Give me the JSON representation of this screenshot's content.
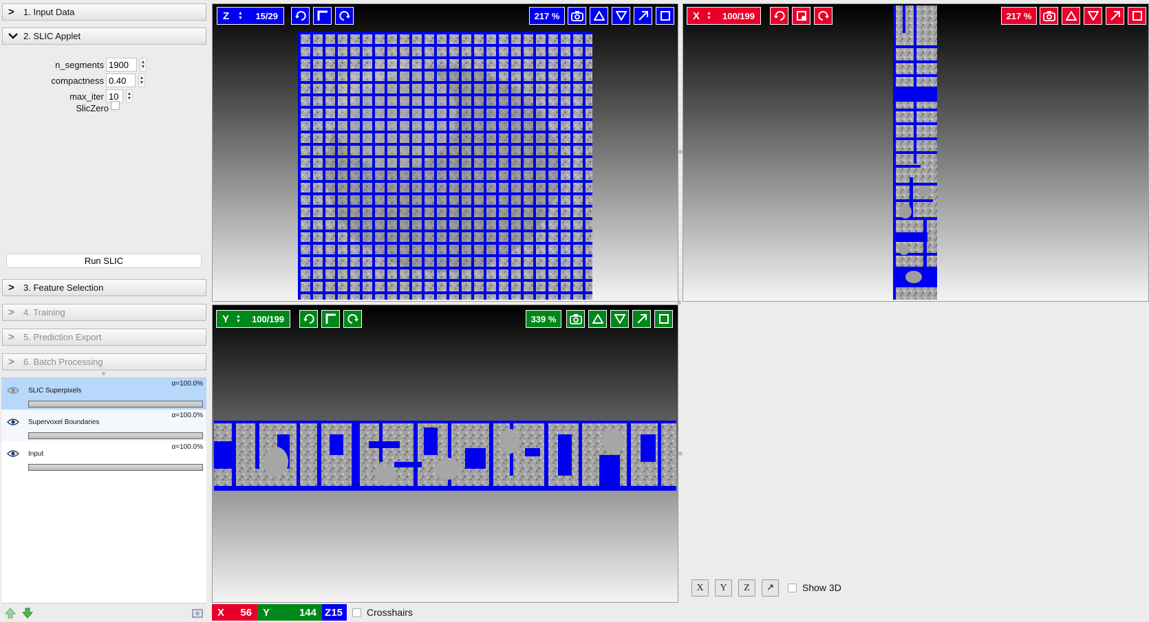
{
  "applets": [
    {
      "label": "1. Input Data",
      "expanded": false,
      "enabled": true
    },
    {
      "label": "2. SLIC Applet",
      "expanded": true,
      "enabled": true
    },
    {
      "label": "3. Feature Selection",
      "expanded": false,
      "enabled": true
    },
    {
      "label": "4. Training",
      "expanded": false,
      "enabled": false
    },
    {
      "label": "5. Prediction Export",
      "expanded": false,
      "enabled": false
    },
    {
      "label": "6. Batch Processing",
      "expanded": false,
      "enabled": false
    }
  ],
  "slic": {
    "n_segments_label": "n_segments",
    "n_segments_value": "1900",
    "compactness_label": "compactness",
    "compactness_value": "0.40",
    "max_iter_label": "max_iter",
    "max_iter_value": "10",
    "slic_zero_label": "SlicZero",
    "slic_zero_checked": false,
    "run_label": "Run SLIC"
  },
  "layers": [
    {
      "name": "SLIC Superpixels",
      "alpha": "α=100.0%",
      "visible": true,
      "selected": true
    },
    {
      "name": "Supervoxel Boundaries",
      "alpha": "α=100.0%",
      "visible": true,
      "selected": false
    },
    {
      "name": "Input",
      "alpha": "α=100.0%",
      "visible": true,
      "selected": false
    }
  ],
  "views": {
    "z": {
      "axis": "Z",
      "slice": "15/29",
      "zoom": "217 %",
      "color": "#0000f0"
    },
    "x": {
      "axis": "X",
      "slice": "100/199",
      "zoom": "217 %",
      "color": "#e8002a"
    },
    "y": {
      "axis": "Y",
      "slice": "100/199",
      "zoom": "339 %",
      "color": "#00871a"
    }
  },
  "position": {
    "x_label": "X",
    "x_value": "56",
    "y_label": "Y",
    "y_value": "144",
    "z_label": "Z",
    "z_value": "15"
  },
  "crosshairs_label": "Crosshairs",
  "show3d_label": "Show 3D",
  "view3d_buttons": [
    "X",
    "Y",
    "Z",
    "↗"
  ],
  "icons": [
    "chevron-right-icon",
    "chevron-down-icon",
    "eye-icon",
    "rotate-left-icon",
    "swap-axes-icon",
    "rotate-right-icon",
    "camera-icon",
    "slice-up-icon",
    "slice-down-icon",
    "maximize-icon",
    "fit-view-icon",
    "arrow-up-icon",
    "arrow-down-icon",
    "layer-settings-icon"
  ]
}
